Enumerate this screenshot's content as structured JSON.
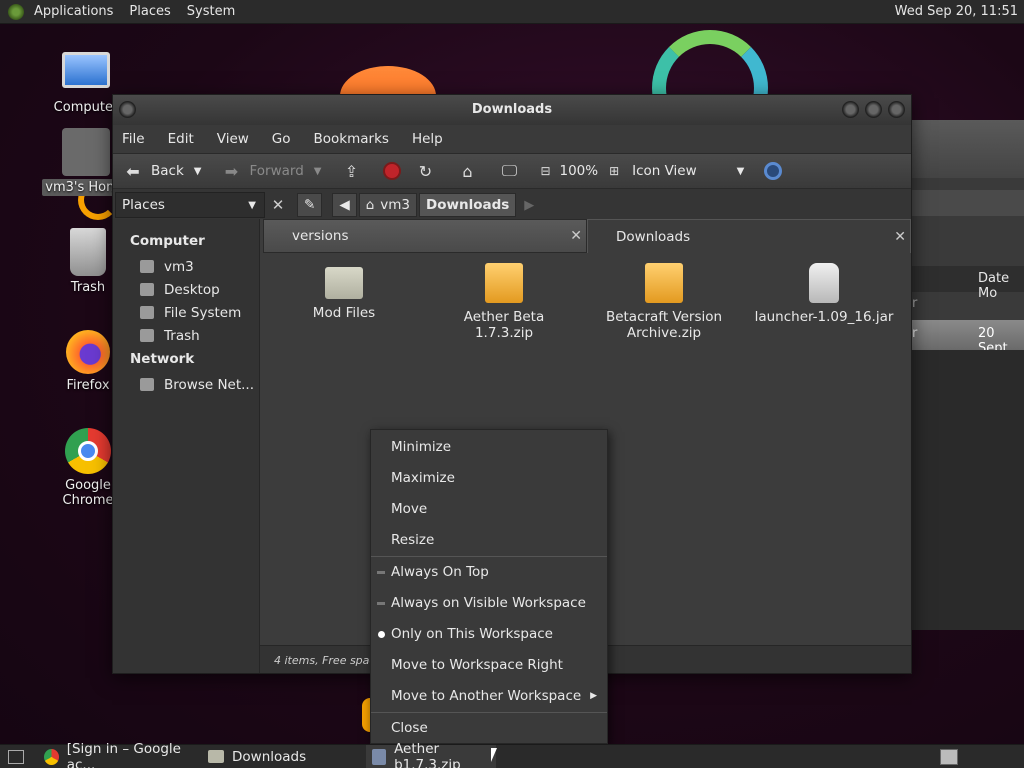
{
  "top_panel": {
    "menus": [
      "Applications",
      "Places",
      "System"
    ],
    "clock": "Wed Sep 20, 11:51"
  },
  "desktop_icons": [
    {
      "label": "Computer",
      "icon": "computer-icon"
    },
    {
      "label": "vm3's Home",
      "icon": "home-folder-icon"
    },
    {
      "label": "Trash",
      "icon": "trash-icon"
    },
    {
      "label": "Firefox",
      "icon": "firefox-icon"
    },
    {
      "label": "Google Chrome",
      "icon": "chrome-icon"
    }
  ],
  "bg_window": {
    "column_header": "Date Mo",
    "row1_prefix": "r",
    "row2_prefix": "r",
    "row_selected": "20 Sept"
  },
  "window": {
    "title": "Downloads",
    "menus": [
      "File",
      "Edit",
      "View",
      "Go",
      "Bookmarks",
      "Help"
    ],
    "toolbar": {
      "back": "Back",
      "forward": "Forward",
      "zoom": "100%",
      "view_mode": "Icon View"
    },
    "places_label": "Places",
    "path": [
      "vm3",
      "Downloads"
    ],
    "sidebar": {
      "computer_heading": "Computer",
      "computer_items": [
        "vm3",
        "Desktop",
        "File System",
        "Trash"
      ],
      "network_heading": "Network",
      "network_items": [
        "Browse Net..."
      ]
    },
    "tabs": [
      {
        "label": "versions",
        "active": false
      },
      {
        "label": "Downloads",
        "active": true
      }
    ],
    "files": [
      {
        "name": "Mod Files",
        "type": "folder"
      },
      {
        "name": "Aether Beta 1.7.3.zip",
        "type": "zip"
      },
      {
        "name": "Betacraft Version Archive.zip",
        "type": "zip"
      },
      {
        "name": "launcher-1.09_16.jar",
        "type": "jar"
      }
    ],
    "status": "4 items, Free space"
  },
  "context_menu": {
    "group1": [
      "Minimize",
      "Maximize",
      "Move",
      "Resize"
    ],
    "group2": [
      {
        "label": "Always On Top",
        "state": "unchecked"
      },
      {
        "label": "Always on Visible Workspace",
        "state": "unchecked"
      },
      {
        "label": "Only on This Workspace",
        "state": "selected"
      },
      {
        "label": "Move to Workspace Right",
        "state": "none"
      },
      {
        "label": "Move to Another Workspace",
        "state": "submenu"
      }
    ],
    "group3": [
      "Close"
    ]
  },
  "taskbar": {
    "items": [
      {
        "label": "[Sign in – Google ac...",
        "icon": "chrome-icon"
      },
      {
        "label": "Downloads",
        "icon": "folder-icon"
      },
      {
        "label": "Aether b1.7.3.zip",
        "icon": "archive-icon"
      }
    ]
  }
}
